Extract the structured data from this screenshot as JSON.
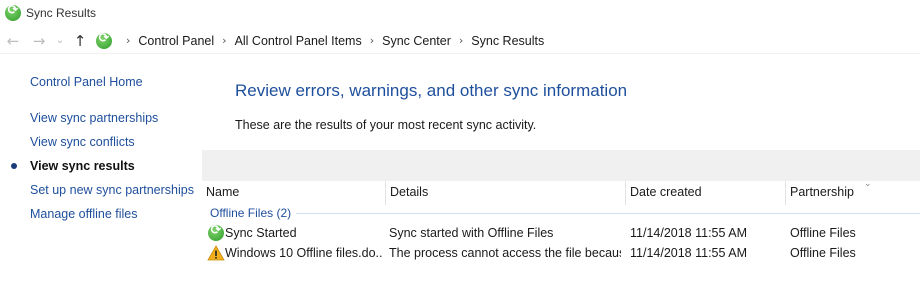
{
  "window": {
    "title": "Sync Results"
  },
  "address": {
    "crumbs": [
      "Control Panel",
      "All Control Panel Items",
      "Sync Center",
      "Sync Results"
    ]
  },
  "sidebar": {
    "home": "Control Panel Home",
    "items": [
      {
        "label": "View sync partnerships"
      },
      {
        "label": "View sync conflicts"
      },
      {
        "label": "View sync results",
        "current": true
      },
      {
        "label": "Set up new sync partnerships"
      },
      {
        "label": "Manage offline files"
      }
    ]
  },
  "main": {
    "heading": "Review errors, warnings, and other sync information",
    "subtext": "These are the results of your most recent sync activity."
  },
  "table": {
    "columns": [
      "Name",
      "Details",
      "Date created",
      "Partnership"
    ],
    "group": "Offline Files (2)",
    "rows": [
      {
        "icon": "sync-icon",
        "name": "Sync Started",
        "details": "Sync started with Offline Files",
        "date": "11/14/2018 11:55 AM",
        "partnership": "Offline Files"
      },
      {
        "icon": "warning-icon",
        "name": "Windows 10 Offline files.do...",
        "details": "The process cannot access the file becaus...",
        "date": "11/14/2018 11:55 AM",
        "partnership": "Offline Files"
      }
    ]
  },
  "colors": {
    "link": "#1e4f9c",
    "toolbar_band": "#f0f0f0",
    "warning": "#f2b01e"
  }
}
